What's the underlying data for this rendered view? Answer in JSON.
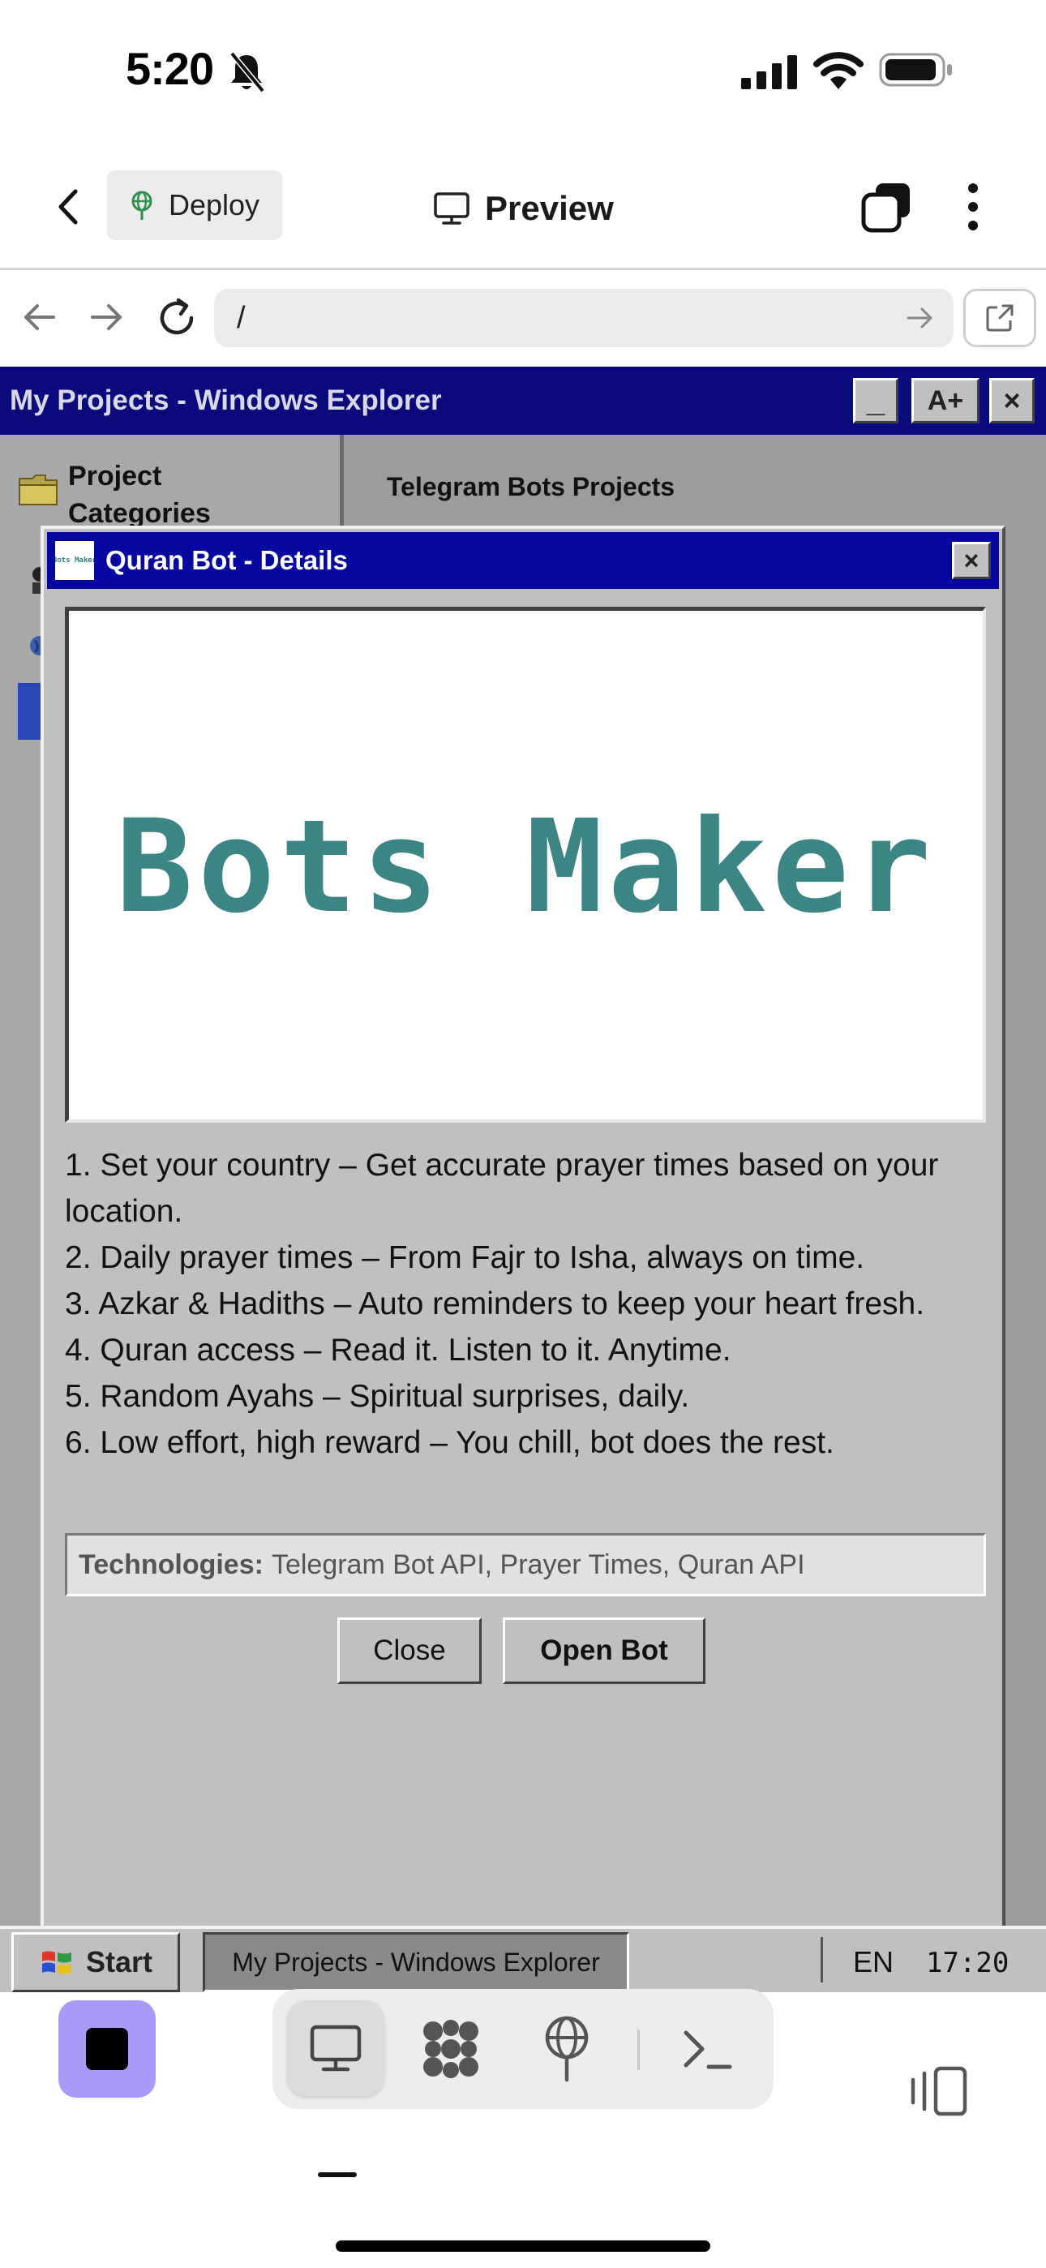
{
  "status_bar": {
    "time": "5:20"
  },
  "header": {
    "deploy_label": "Deploy",
    "preview_label": "Preview"
  },
  "browser": {
    "url": "/"
  },
  "explorer": {
    "window_title": "My Projects - Windows Explorer",
    "title_buttons": {
      "minimize": "_",
      "font_size": "A+",
      "close": "×"
    },
    "sidebar_label": "Project Categories",
    "main_heading": "Telegram Bots Projects"
  },
  "dialog": {
    "title": "Quran Bot - Details",
    "app_icon_text": "Bots Maker",
    "close_glyph": "×",
    "preview_logo_text": "Bots Maker",
    "features": [
      "1. Set your country – Get accurate prayer times based on your location.",
      "2. Daily prayer times – From Fajr to Isha, always on time.",
      "3. Azkar & Hadiths – Auto reminders to keep your heart fresh.",
      "4. Quran access – Read it. Listen to it. Anytime.",
      "5. Random Ayahs – Spiritual surprises, daily.",
      "6. Low effort, high reward – You chill, bot does the rest."
    ],
    "technologies_label": "Technologies:",
    "technologies_value": "Telegram Bot API, Prayer Times, Quran API",
    "close_button": "Close",
    "open_bot_button": "Open Bot"
  },
  "taskbar": {
    "start_label": "Start",
    "task_item": "My Projects - Windows Explorer",
    "language": "EN",
    "clock": "17:20"
  },
  "colors": {
    "explorer_titlebar": "#0a0a7c",
    "dialog_titlebar": "#0606a0",
    "win98_face": "#c0c0c0",
    "logo_teal": "#3c8585",
    "stop_button": "#a99af7"
  },
  "icons": {
    "status": [
      "bell-slash-icon",
      "signal-icon",
      "wifi-icon",
      "battery-icon"
    ],
    "header": [
      "chevron-left-icon",
      "deploy-globe-icon",
      "monitor-icon",
      "tabs-icon",
      "more-vertical-icon"
    ],
    "browser": [
      "arrow-left-icon",
      "arrow-right-icon",
      "reload-icon",
      "arrow-go-icon",
      "external-link-icon"
    ],
    "toolbar": [
      "stop-icon",
      "monitor-icon",
      "puzzle-icon",
      "deploy-globe-icon",
      "terminal-icon",
      "split-view-icon"
    ]
  }
}
